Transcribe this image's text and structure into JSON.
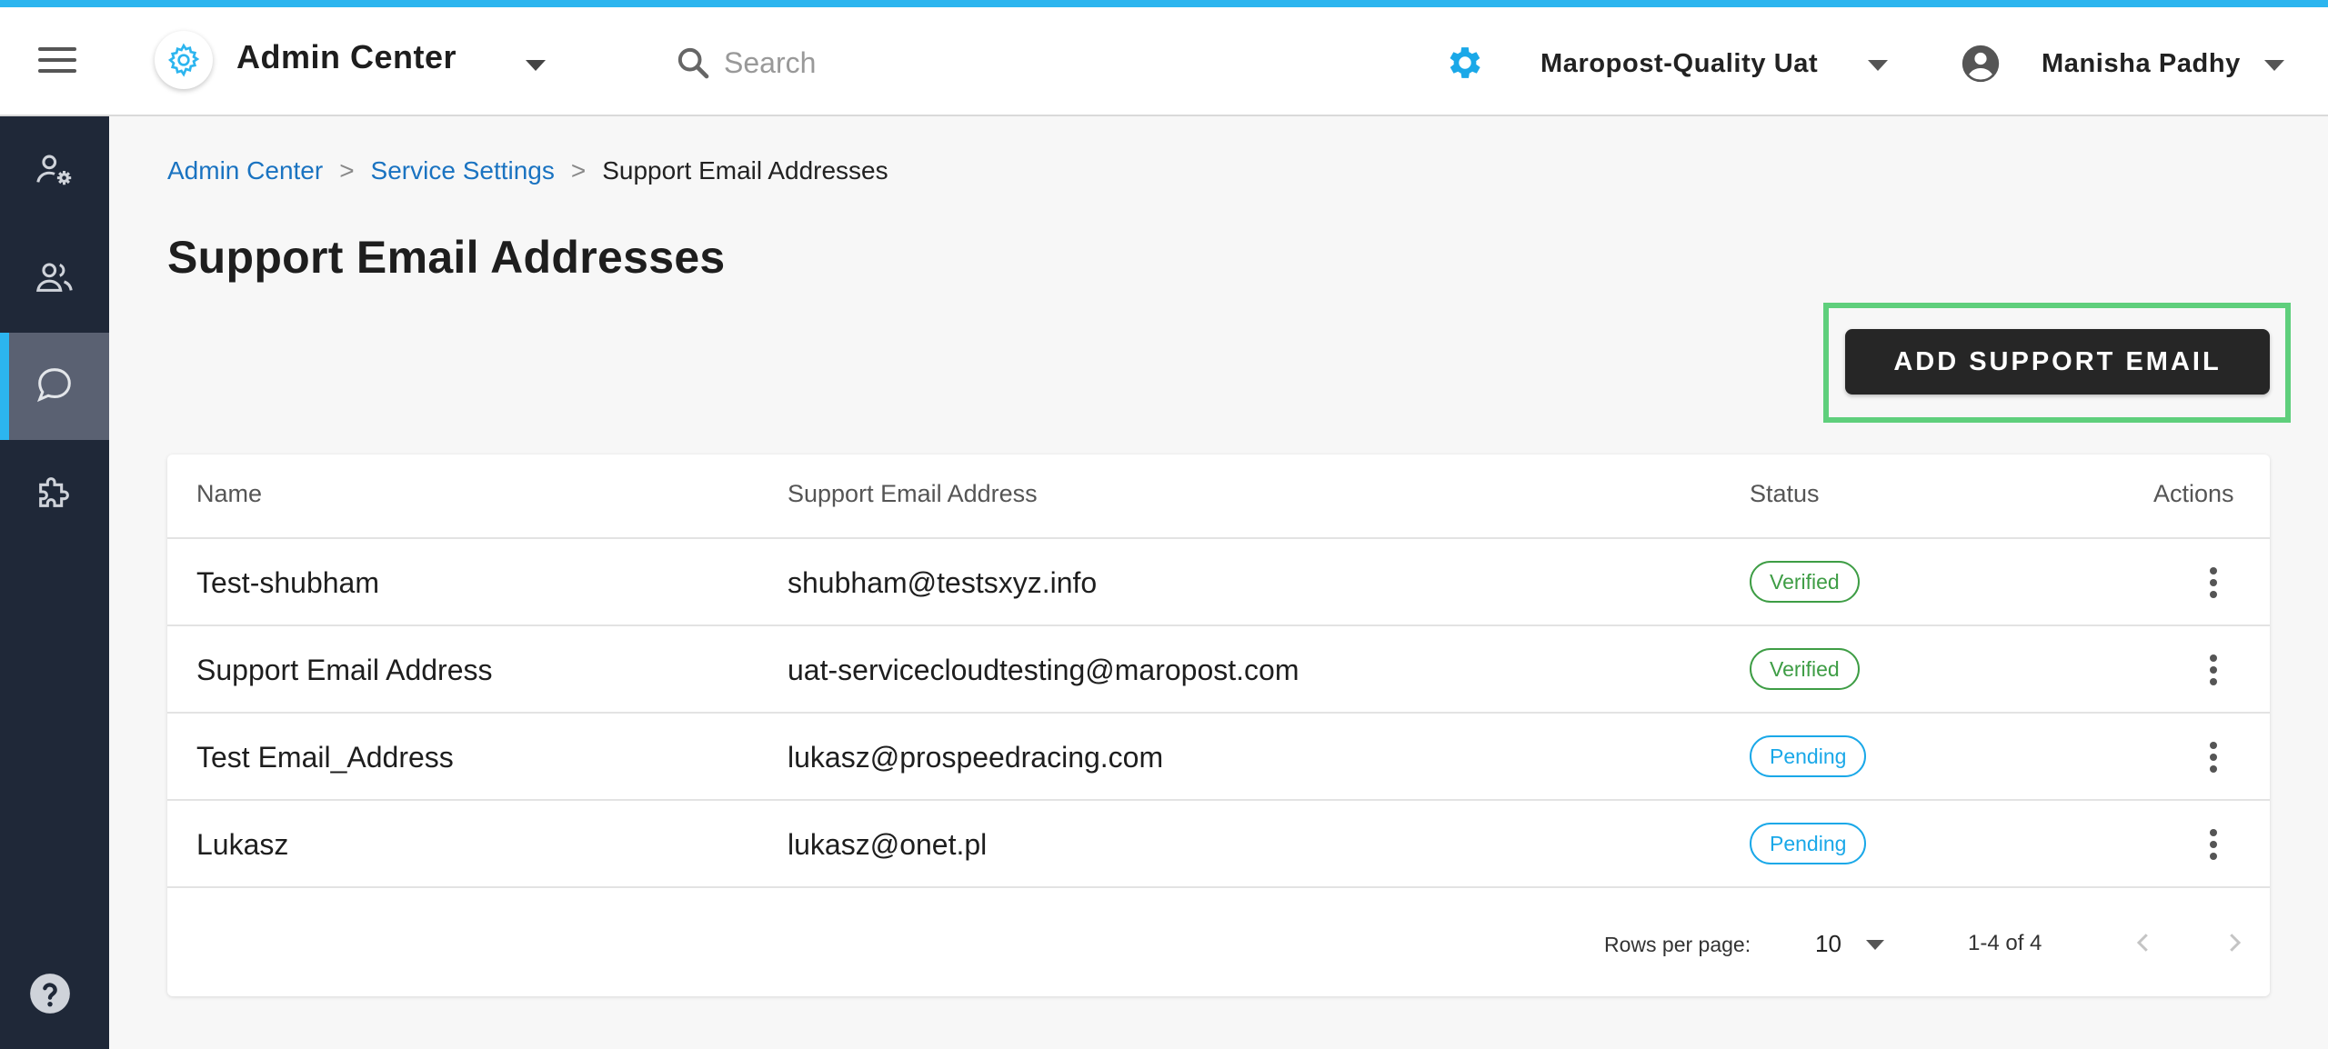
{
  "app": {
    "title": "Admin Center",
    "accent_color": "#2cb5ef",
    "logo_icon": "gear-icon"
  },
  "search": {
    "placeholder": "Search"
  },
  "org": {
    "name": "Maropost-Quality Uat",
    "icon": "gear-icon"
  },
  "user": {
    "name": "Manisha Padhy",
    "icon": "account-circle-icon"
  },
  "sidebar": {
    "items": [
      {
        "icon": "user-settings-icon",
        "active": false
      },
      {
        "icon": "people-icon",
        "active": false
      },
      {
        "icon": "chat-bubble-icon",
        "active": true
      },
      {
        "icon": "puzzle-piece-icon",
        "active": false
      }
    ],
    "help_icon": "help-circle-icon"
  },
  "breadcrumb": {
    "items": [
      "Admin Center",
      "Service Settings",
      "Support Email Addresses"
    ],
    "separator": ">"
  },
  "page": {
    "title": "Support Email Addresses",
    "add_button_label": "ADD SUPPORT EMAIL"
  },
  "table": {
    "columns": [
      "Name",
      "Support Email Address",
      "Status",
      "Actions"
    ],
    "rows": [
      {
        "name": "Test-shubham",
        "email": "shubham@testsxyz.info",
        "status": "Verified"
      },
      {
        "name": "Support Email Address",
        "email": "uat-servicecloudtesting@maropost.com",
        "status": "Verified"
      },
      {
        "name": "Test Email_Address",
        "email": "lukasz@prospeedracing.com",
        "status": "Pending"
      },
      {
        "name": "Lukasz",
        "email": "lukasz@onet.pl",
        "status": "Pending"
      }
    ],
    "status_colors": {
      "Verified": "#3e9d45",
      "Pending": "#1aa8e8"
    }
  },
  "pagination": {
    "rows_per_page_label": "Rows per page:",
    "rows_per_page": "10",
    "range": "1-4 of 4"
  }
}
